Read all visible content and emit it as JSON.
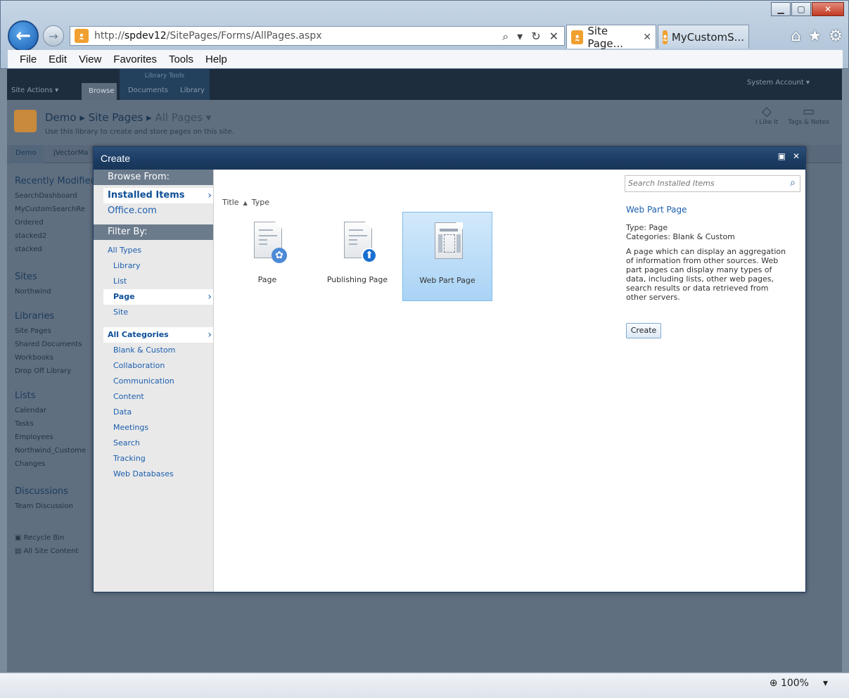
{
  "browser": {
    "url_prefix": "http://",
    "url_host": "spdev12",
    "url_path": "/SitePages/Forms/AllPages.aspx",
    "tabs": [
      {
        "label": "Site Page...",
        "close": "✕"
      },
      {
        "label": "MyCustomS..."
      }
    ],
    "menu": [
      "File",
      "Edit",
      "View",
      "Favorites",
      "Tools",
      "Help"
    ],
    "zoom": "100%"
  },
  "ribbon": {
    "site_actions": "Site Actions ▾",
    "lib_tools": "Library Tools",
    "tabs": [
      "Browse",
      "Documents",
      "Library"
    ],
    "account": "System Account ▾"
  },
  "page": {
    "breadcrumb": [
      "Demo",
      "Site Pages",
      "All Pages ▾"
    ],
    "description": "Use this library to create and store pages on this site.",
    "social": [
      "I Like It",
      "Tags & Notes"
    ],
    "topnav": [
      "Demo",
      "jVectorMa"
    ]
  },
  "quicklaunch": {
    "recent_heading": "Recently Modified",
    "recent": [
      "SearchDashboard",
      "MyCustomSearchRe",
      "Ordered",
      "stacked2",
      "stacked"
    ],
    "sites_heading": "Sites",
    "sites": [
      "Northwind"
    ],
    "libraries_heading": "Libraries",
    "libraries": [
      "Site Pages",
      "Shared Documents",
      "Workbooks",
      "Drop Off Library"
    ],
    "lists_heading": "Lists",
    "lists": [
      "Calendar",
      "Tasks",
      "Employees",
      "Northwind_Custome",
      "Changes"
    ],
    "discussions_heading": "Discussions",
    "discussions": [
      "Team Discussion"
    ],
    "footer": [
      "Recycle Bin",
      "All Site Content"
    ]
  },
  "dialog": {
    "title": "Create",
    "browse_from": "Browse From:",
    "installed_items": "Installed Items",
    "office_com": "Office.com",
    "filter_by": "Filter By:",
    "all_types": "All Types",
    "types": [
      "Library",
      "List",
      "Page",
      "Site"
    ],
    "selected_type": "Page",
    "all_categories": "All Categories",
    "categories": [
      "Blank & Custom",
      "Collaboration",
      "Communication",
      "Content",
      "Data",
      "Meetings",
      "Search",
      "Tracking",
      "Web Databases"
    ],
    "sort_title": "Title",
    "sort_type": "Type",
    "items": [
      "Page",
      "Publishing Page",
      "Web Part Page"
    ],
    "selected_item": "Web Part Page",
    "search_placeholder": "Search Installed Items",
    "detail": {
      "title": "Web Part Page",
      "type": "Type: Page",
      "categories": "Categories: Blank & Custom",
      "description": "A page which can display an aggregation of information from other sources. Web part pages can display many types of data, including lists, other web pages, search results or data retrieved from other servers.",
      "create_label": "Create"
    }
  }
}
